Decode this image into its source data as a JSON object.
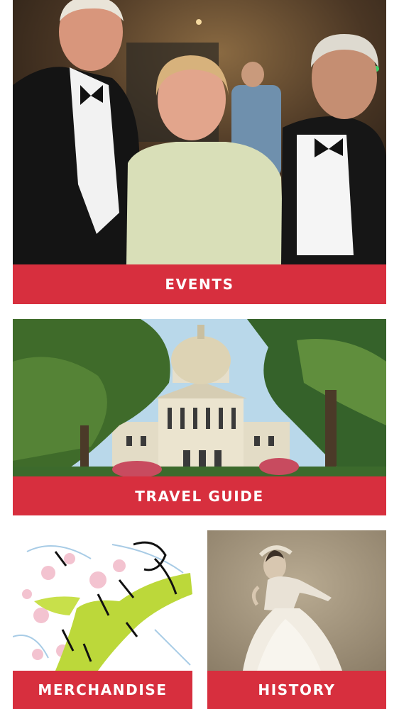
{
  "cards": {
    "events": {
      "label": "EVENTS"
    },
    "travel_guide": {
      "label": "TRAVEL GUIDE"
    },
    "merchandise": {
      "label": "MERCHANDISE"
    },
    "history": {
      "label": "HISTORY"
    }
  },
  "colors": {
    "label_bar": "#d72f3e",
    "label_text": "#ffffff",
    "page_background": "#ffffff"
  }
}
